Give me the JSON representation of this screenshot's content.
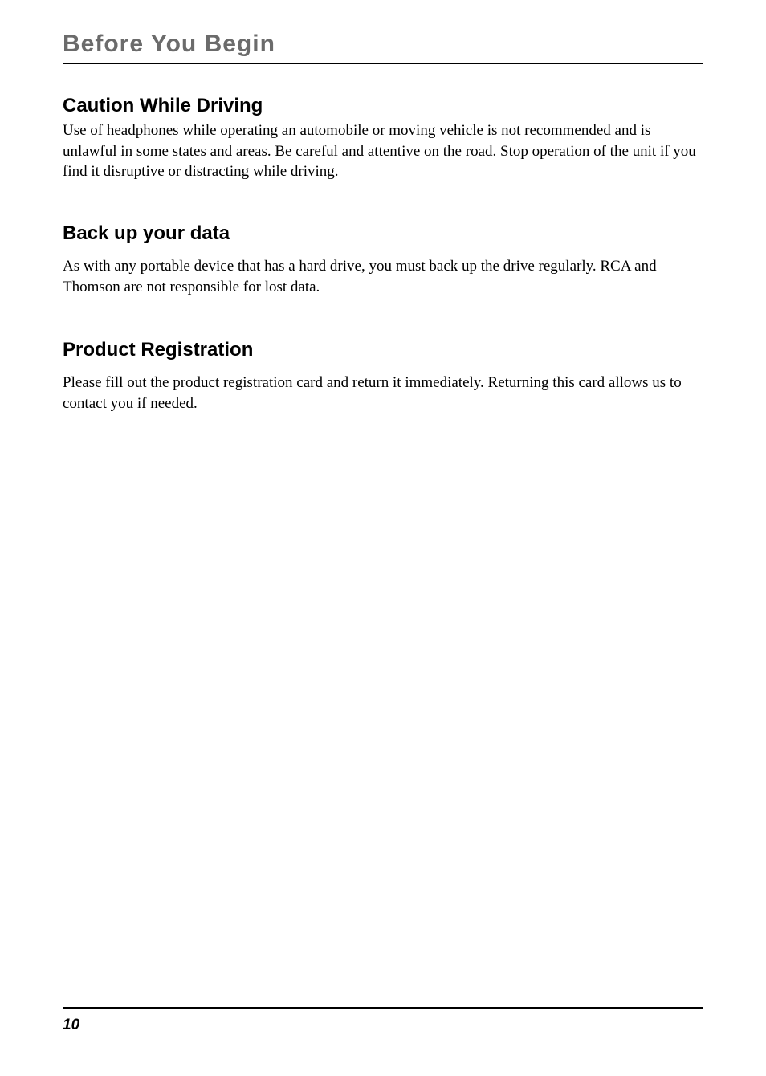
{
  "chapter_title": "Before You Begin",
  "sections": [
    {
      "heading": "Caution While Driving",
      "body": "Use of headphones while operating an automobile or moving vehicle is not recommended and is unlawful in some states and areas. Be careful and attentive on the road. Stop operation of the unit if you find it disruptive or distracting while driving."
    },
    {
      "heading": "Back up your data",
      "body": "As with any portable device that has a hard drive, you must back up the drive regularly. RCA and Thomson are not responsible for lost data."
    },
    {
      "heading": "Product Registration",
      "body": "Please fill out the product registration card and return it immediately.  Returning this card allows us to contact you if needed."
    }
  ],
  "page_number": "10"
}
